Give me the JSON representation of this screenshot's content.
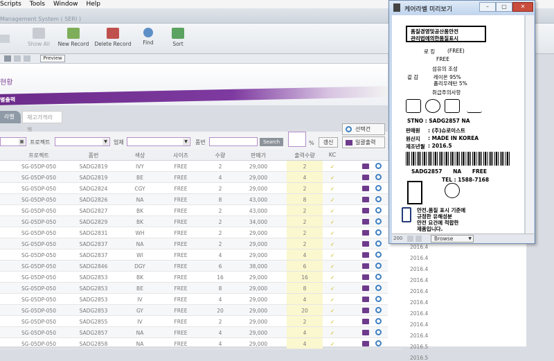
{
  "menu": [
    "Scripts",
    "Tools",
    "Window",
    "Help"
  ],
  "app_title": "Management System ( SERI )",
  "toolbar": {
    "show_all": "Show All",
    "new_record": "New Record",
    "delete_record": "Delete Record",
    "find": "Find",
    "sort": "Sort",
    "preview": "Preview"
  },
  "page": {
    "title": "현황",
    "section": "별출력"
  },
  "tabs": [
    "라벨",
    "재고가격라벨"
  ],
  "filters": {
    "project_label": "프로젝트",
    "vendor_label": "업체",
    "item_label": "품번",
    "search": "Search",
    "pct": "%",
    "refresh": "갱신",
    "select": "선택건",
    "bulk_print": "일괄출력"
  },
  "table": {
    "headers": [
      "프로젝트",
      "품번",
      "색상",
      "사이즈",
      "수량",
      "판매가",
      "출력수량",
      "KC"
    ],
    "rows": [
      [
        "SG-05DP-050",
        "SADG2819",
        "IVY",
        "FREE",
        "2",
        "29,000",
        "2",
        "✓"
      ],
      [
        "SG-05DP-050",
        "SADG2819",
        "BE",
        "FREE",
        "4",
        "29,000",
        "4",
        "✓"
      ],
      [
        "SG-05DP-050",
        "SADG2824",
        "CGY",
        "FREE",
        "2",
        "29,000",
        "2",
        "✓"
      ],
      [
        "SG-05DP-050",
        "SADG2826",
        "NA",
        "FREE",
        "8",
        "43,000",
        "8",
        "✓"
      ],
      [
        "SG-05DP-050",
        "SADG2827",
        "BK",
        "FREE",
        "2",
        "43,000",
        "2",
        "✓"
      ],
      [
        "SG-05DP-050",
        "SADG2829",
        "BK",
        "FREE",
        "2",
        "34,000",
        "2",
        "✓"
      ],
      [
        "SG-05DP-050",
        "SADG2831",
        "WH",
        "FREE",
        "2",
        "29,000",
        "2",
        "✓"
      ],
      [
        "SG-05DP-050",
        "SADG2837",
        "NA",
        "FREE",
        "2",
        "29,000",
        "2",
        "✓"
      ],
      [
        "SG-05DP-050",
        "SADG2837",
        "WI",
        "FREE",
        "4",
        "29,000",
        "4",
        "✓"
      ],
      [
        "SG-05DP-050",
        "SADG2846",
        "DGY",
        "FREE",
        "6",
        "38,000",
        "6",
        "✓"
      ],
      [
        "SG-05DP-050",
        "SADG2853",
        "BK",
        "FREE",
        "16",
        "29,000",
        "16",
        "✓"
      ],
      [
        "SG-05DP-050",
        "SADG2853",
        "BE",
        "FREE",
        "8",
        "29,000",
        "8",
        "✓"
      ],
      [
        "SG-05DP-050",
        "SADG2853",
        "IV",
        "FREE",
        "4",
        "29,000",
        "4",
        "✓"
      ],
      [
        "SG-05DP-050",
        "SADG2853",
        "GY",
        "FREE",
        "20",
        "29,000",
        "20",
        "✓"
      ],
      [
        "SG-05DP-050",
        "SADG2855",
        "IV",
        "FREE",
        "2",
        "29,000",
        "2",
        "✓"
      ],
      [
        "SG-05DP-050",
        "SADG2857",
        "NA",
        "FREE",
        "4",
        "29,000",
        "4",
        "✓"
      ],
      [
        "SG-05DP-050",
        "SADG2858",
        "NA",
        "FREE",
        "4",
        "29,000",
        "4",
        "✓"
      ]
    ],
    "dates": [
      "2016.4",
      "2016.4",
      "2016.4",
      "2016.4",
      "2016.4",
      "2016.4",
      "2016.4",
      "2016.4",
      "2016.4",
      "2016.5",
      "2016.5"
    ]
  },
  "preview": {
    "window_title": "케어라벨 미리보기",
    "header_line1": "품질경영및공산품안전",
    "header_line2": "관리법에의한품질표시",
    "brand_label": "로 킹",
    "brand_value": "(FREE)",
    "size": "FREE",
    "composition_title": "섬유의 조성",
    "part_label": "겉 감",
    "comp1": "레이온 95%",
    "comp2": "폴리우레탄 5%",
    "care_title": "취급주의사항",
    "stno_line": "STNO : SADG2857     NA",
    "seller_label": "판매원",
    "seller_value": ": (주)슈로이스트",
    "origin_label": "원산지",
    "origin_value": ": MADE IN KOREA",
    "date_label": "제조년월",
    "date_value": ": 2016.5",
    "barcode_text": "SADG2857      NA      FREE",
    "tel": "TEL : 1588-7168",
    "kc_line1": "안전.품질 표시 기준에",
    "kc_line2": "규정한 유해성분",
    "kc_line3": "안전 요건에 적합한",
    "kc_line4": "제품입니다.",
    "zoom": "200",
    "browse": "Browse"
  }
}
